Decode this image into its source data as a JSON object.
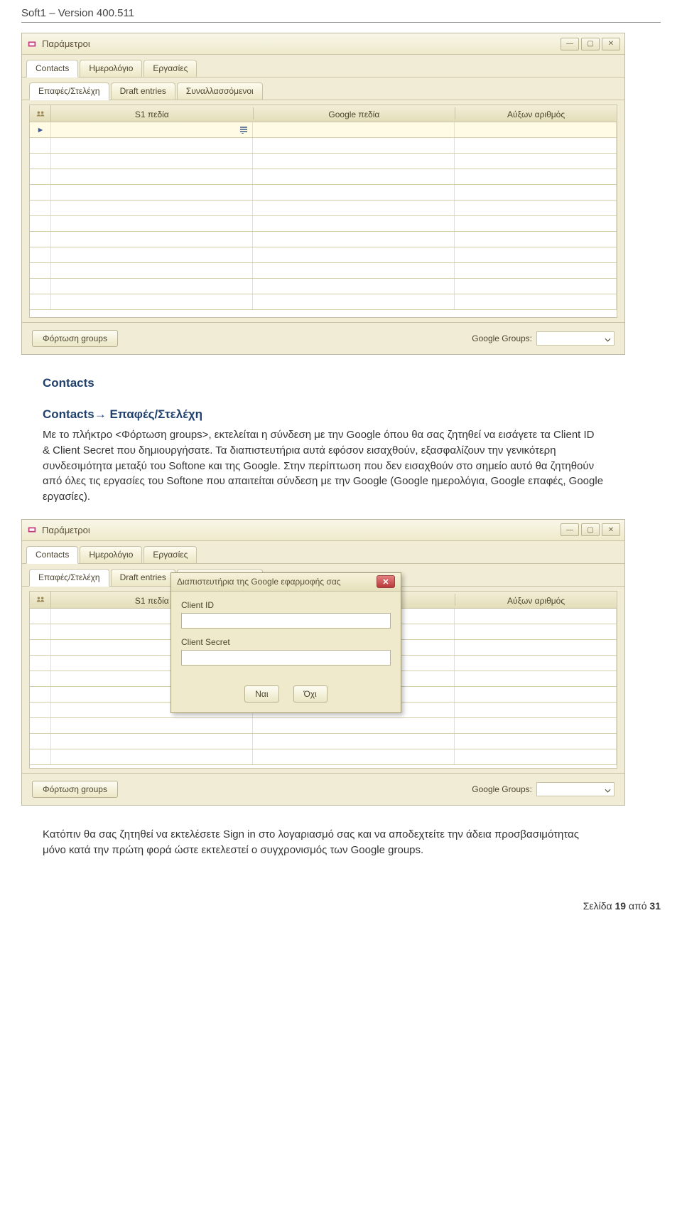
{
  "page": {
    "header": "Soft1 – Version 400.511",
    "footer_prefix": "Σελίδα ",
    "footer_page": "19",
    "footer_mid": " από ",
    "footer_total": "31"
  },
  "window": {
    "title": "Παράμετροι",
    "min_tooltip": "Minimize",
    "max_tooltip": "Maximize",
    "close_tooltip": "Close"
  },
  "main_tabs": {
    "contacts": "Contacts",
    "calendar": "Ημερολόγιο",
    "tasks": "Εργασίες"
  },
  "sub_tabs": {
    "contacts_staff": "Επαφές/Στελέχη",
    "draft": "Draft entries",
    "transactors": "Συναλλασσόμενοι"
  },
  "grid": {
    "headers": {
      "s1": "S1 πεδία",
      "google": "Google πεδία",
      "serial": "Αύξων αριθμός"
    }
  },
  "footer_bar": {
    "load_groups": "Φόρτωση groups",
    "google_groups_label": "Google Groups:"
  },
  "doc": {
    "h1": "Contacts",
    "h2_prefix": "Contacts",
    "h2_arrow": "→",
    "h2_rest": " Επαφές/Στελέχη",
    "para1": "Με το πλήκτρο <Φόρτωση groups>, εκτελείται η σύνδεση με την Google όπου θα σας ζητηθεί να εισάγετε τα Client ID & Client Secret που δημιουργήσατε. Τα διαπιστευτήρια αυτά εφόσον εισαχθούν, εξασφαλίζουν την γενικότερη συνδεσιμότητα μεταξύ του Softone και της Google. Στην περίπτωση που δεν εισαχθούν στο σημείο αυτό θα ζητηθούν από όλες τις εργασίες του Softone που απαιτείται σύνδεση με την Google (Google ημερολόγια, Google επαφές, Google εργασίες).",
    "para2": "Κατόπιν θα σας ζητηθεί να εκτελέσετε Sign in στο λογαριασμό σας και να αποδεχτείτε την άδεια προσβασιμότητας  μόνο κατά την πρώτη φορά ώστε εκτελεστεί ο συγχρονισμός των Google groups."
  },
  "dialog": {
    "title": "Διαπιστευτήρια της Google εφαρμοφής σας",
    "client_id_label": "Client ID",
    "client_secret_label": "Client Secret",
    "yes": "Ναι",
    "no": "Όχι"
  }
}
